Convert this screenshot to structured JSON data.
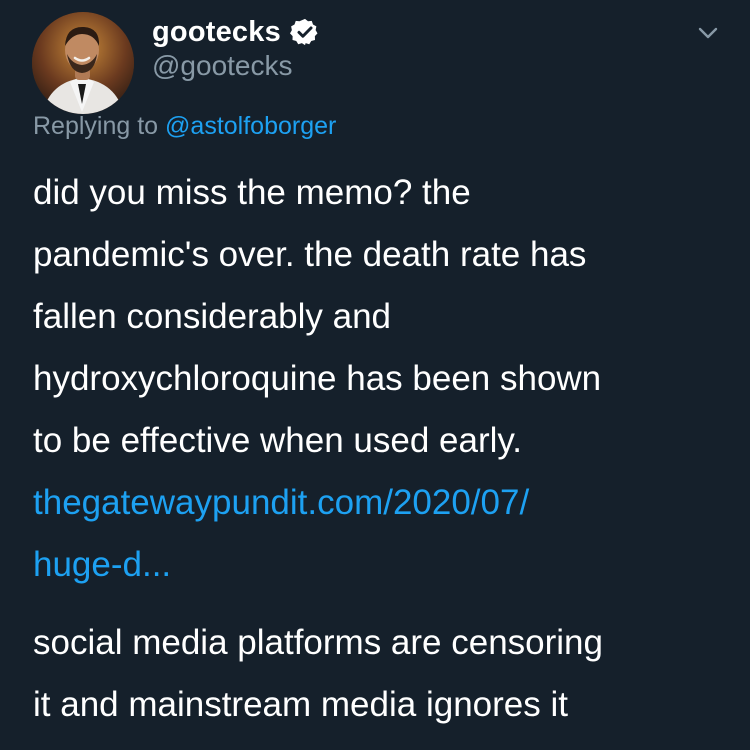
{
  "tweet": {
    "display_name": "gootecks",
    "handle": "@gootecks",
    "replying_prefix": "Replying to",
    "replying_to": "@astolfoborger",
    "paragraph1_lines": [
      "did you miss the memo?  the",
      "pandemic's over.  the death rate has",
      "fallen considerably and",
      "hydroxychloroquine has been shown",
      "to be effective when used early."
    ],
    "link_lines": [
      "thegatewaypundit.com/2020/07/",
      "huge-d..."
    ],
    "paragraph2_lines": [
      "social media platforms are censoring",
      "it and mainstream media ignores it"
    ]
  },
  "icons": {
    "verified": "verified-badge-icon",
    "chevron": "chevron-down-icon"
  },
  "colors": {
    "background": "#15202b",
    "text": "#ffffff",
    "secondary_text": "#8899a6",
    "link": "#1da1f2"
  }
}
